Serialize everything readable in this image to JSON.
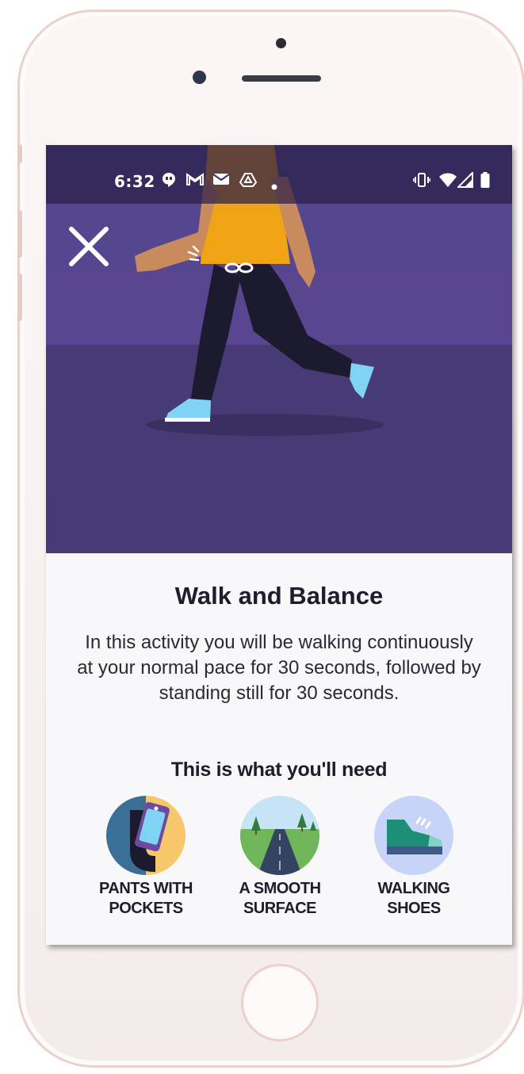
{
  "status_bar": {
    "time": "6:32",
    "left_icons": [
      "hangouts-icon",
      "gmail-icon",
      "email-icon",
      "drive-icon",
      "dot-icon"
    ],
    "right_icons": [
      "vibrate-icon",
      "wifi-icon",
      "signal-icon",
      "battery-icon"
    ]
  },
  "activity": {
    "title": "Walk and Balance",
    "description": "In this activity you will be walking continuously at your normal pace for 30 seconds,  followed by standing still for 30 seconds.",
    "needs_title": "This is what you'll need",
    "needs": [
      {
        "label": "PANTS WITH\nPOCKETS",
        "icon": "phone-in-pocket-icon"
      },
      {
        "label": "A SMOOTH\nSURFACE",
        "icon": "road-icon"
      },
      {
        "label": "WALKING\nSHOES",
        "icon": "shoe-icon"
      }
    ]
  },
  "colors": {
    "hero_bg": "#4a3b79",
    "status_bg": "#2b1e48",
    "shirt": "#f0a315",
    "pants": "#1c1a2e",
    "shoes": "#7fd3f5",
    "skin": "#c98a5e"
  }
}
